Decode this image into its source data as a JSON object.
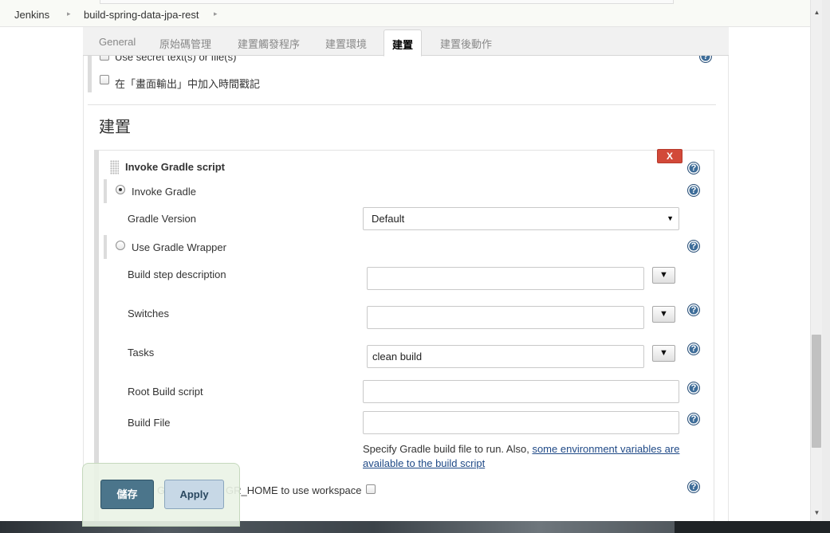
{
  "breadcrumb": {
    "items": [
      "Jenkins",
      "build-spring-data-jpa-rest"
    ],
    "separator": "▸"
  },
  "tabs": [
    {
      "label": "General",
      "active": false
    },
    {
      "label": "原始碼管理",
      "active": false
    },
    {
      "label": "建置觸發程序",
      "active": false
    },
    {
      "label": "建置環境",
      "active": false
    },
    {
      "label": "建置",
      "active": true
    },
    {
      "label": "建置後動作",
      "active": false
    }
  ],
  "build_env": {
    "secret_label": "Use secret text(s) or file(s)",
    "timestamp_label": "在「畫面輸出」中加入時間戳記"
  },
  "section": {
    "title": "建置"
  },
  "builder": {
    "title": "Invoke Gradle script",
    "delete_label": "X",
    "invoke_gradle_label": "Invoke Gradle",
    "gradle_version_label": "Gradle Version",
    "gradle_version_value": "Default",
    "use_wrapper_label": "Use Gradle Wrapper",
    "build_step_label": "Build step description",
    "build_step_value": "",
    "switches_label": "Switches",
    "switches_value": "",
    "tasks_label": "Tasks",
    "tasks_value": "clean build",
    "root_script_label": "Root Build script",
    "root_script_value": "",
    "build_file_label": "Build File",
    "build_file_value": "",
    "desc_prefix": "Specify Gradle build file to run. Also, ",
    "desc_link": "some environment variables are available to the build script",
    "gradle_home_label": "GR_HOME to use workspace",
    "gradle_home_prefix": "G",
    "expand_glyph": "▼",
    "help_glyph": "?"
  },
  "bottom": {
    "save_label": "儲存",
    "apply_label": "Apply"
  },
  "colors": {
    "save_button": "#4b758b",
    "apply_button": "#c7d8e6",
    "delete_button": "#d24939",
    "help_icon": "#3e6d99"
  }
}
